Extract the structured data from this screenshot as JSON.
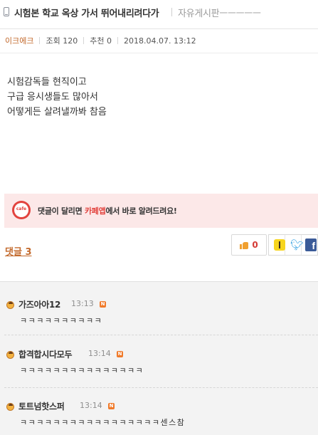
{
  "header": {
    "title": "시험본 학교 옥상 가서 뛰어내리려다가",
    "board": "자유게시판ㅡㅡㅡㅡㅡ"
  },
  "meta": {
    "author": "이크에크",
    "views": "조회 120",
    "recommend": "추천 0",
    "datetime": "2018.04.07. 13:12"
  },
  "post": {
    "lines": [
      "시험감독들 현직이고",
      "구급 응시생들도 많아서",
      "어떻게든 살려낼까봐 참음"
    ]
  },
  "cafe_banner": {
    "prefix": "댓글이 달리면 ",
    "app_name": "카페앱",
    "suffix": "에서 바로 알려드려요!",
    "logo_text": "cafe"
  },
  "actions": {
    "reply_label": "댓글 3",
    "like_count": "0"
  },
  "comments": [
    {
      "nick": "가즈아아12",
      "time": "13:13",
      "badge": "N",
      "text": "ㅋㅋㅋㅋㅋㅋㅋㅋㅋㅋ"
    },
    {
      "nick": "합격합시다모두",
      "time": "13:14",
      "badge": "N",
      "text": "ㅋㅋㅋㅋㅋㅋㅋㅋㅋㅋㅋㅋㅋㅋㅋ"
    },
    {
      "nick": "토트넘핫스퍼",
      "time": "13:14",
      "badge": "N",
      "text": "ㅋㅋㅋㅋㅋㅋㅋㅋㅋㅋㅋㅋㅋㅋㅋㅋㅋ센스참"
    }
  ],
  "colors": {
    "accent": "#c36a2d",
    "cafe_red": "#e2433e",
    "banner_bg": "#fce8e8",
    "comments_bg": "#f3f3f3"
  }
}
